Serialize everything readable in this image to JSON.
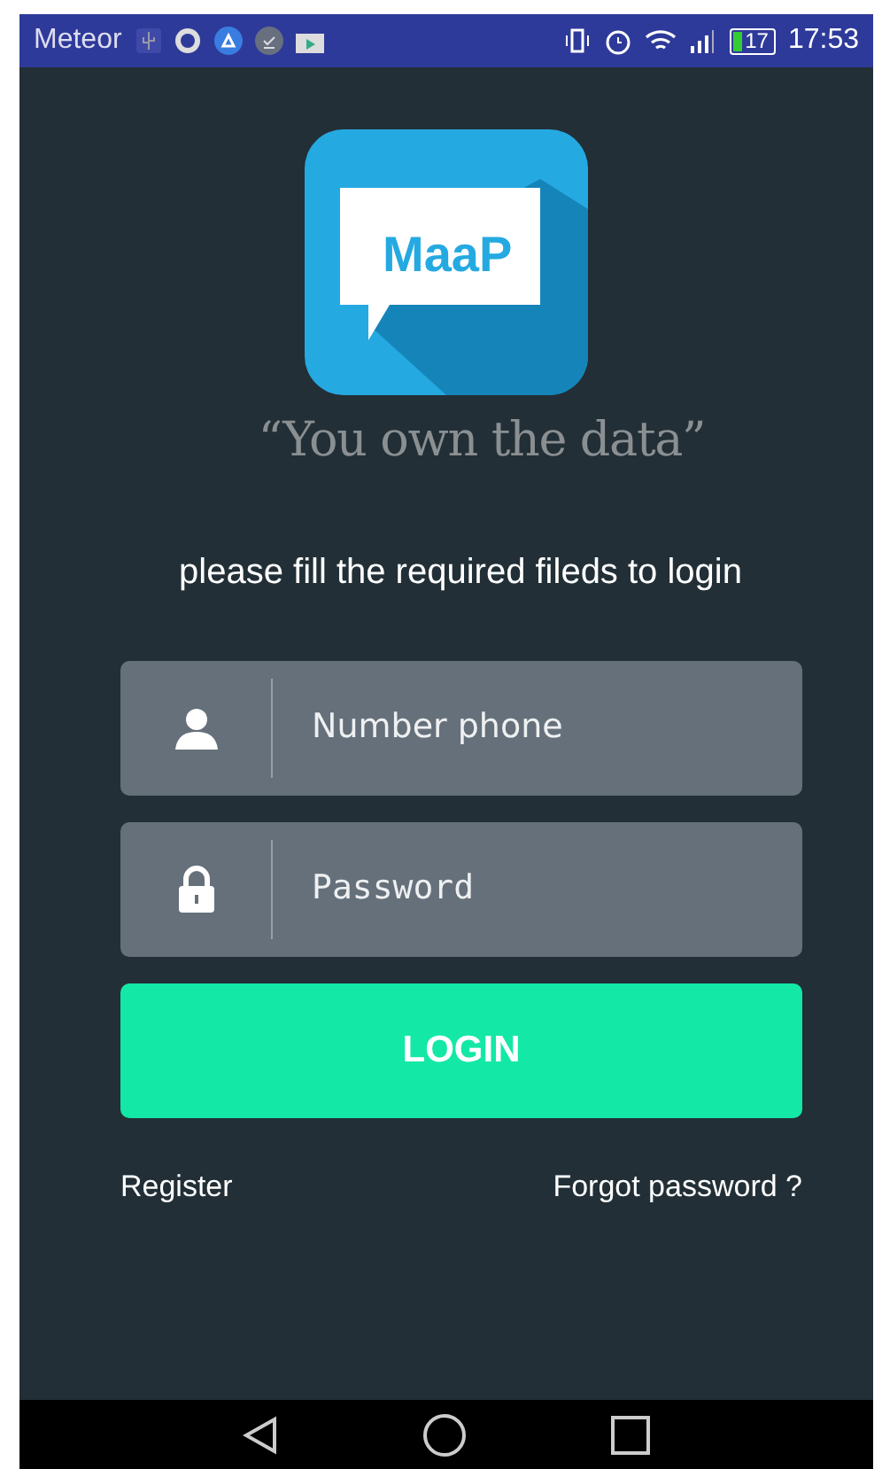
{
  "status_bar": {
    "carrier": "Meteor",
    "battery": "17",
    "time": "17:53"
  },
  "logo": {
    "text": "MaaP"
  },
  "tagline": "“You own the data”",
  "instruction": "please fill the required fileds to login",
  "fields": [
    {
      "kind": "phone",
      "placeholder": "Number phone"
    },
    {
      "kind": "password",
      "placeholder": "Password"
    }
  ],
  "login_button": "LOGIN",
  "links": [
    "Register",
    "Forgot password ?"
  ]
}
